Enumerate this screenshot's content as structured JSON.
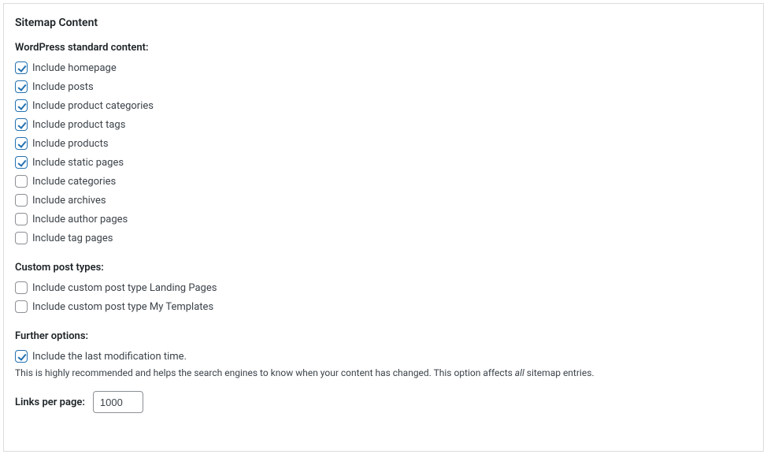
{
  "panel": {
    "title": "Sitemap Content"
  },
  "sections": {
    "standard": {
      "heading": "WordPress standard content:",
      "items": [
        {
          "label": "Include homepage",
          "checked": true
        },
        {
          "label": "Include posts",
          "checked": true
        },
        {
          "label": "Include product categories",
          "checked": true
        },
        {
          "label": "Include product tags",
          "checked": true
        },
        {
          "label": "Include products",
          "checked": true
        },
        {
          "label": "Include static pages",
          "checked": true
        },
        {
          "label": "Include categories",
          "checked": false
        },
        {
          "label": "Include archives",
          "checked": false
        },
        {
          "label": "Include author pages",
          "checked": false
        },
        {
          "label": "Include tag pages",
          "checked": false
        }
      ]
    },
    "custom": {
      "heading": "Custom post types:",
      "items": [
        {
          "label": "Include custom post type Landing Pages",
          "checked": false
        },
        {
          "label": "Include custom post type My Templates",
          "checked": false
        }
      ]
    },
    "further": {
      "heading": "Further options:",
      "modtime": {
        "label": "Include the last modification time.",
        "checked": true,
        "desc_before": "This is highly recommended and helps the search engines to know when your content has changed. This option affects ",
        "desc_em": "all",
        "desc_after": " sitemap entries."
      },
      "links_per_page": {
        "label": "Links per page:",
        "value": "1000"
      }
    }
  }
}
